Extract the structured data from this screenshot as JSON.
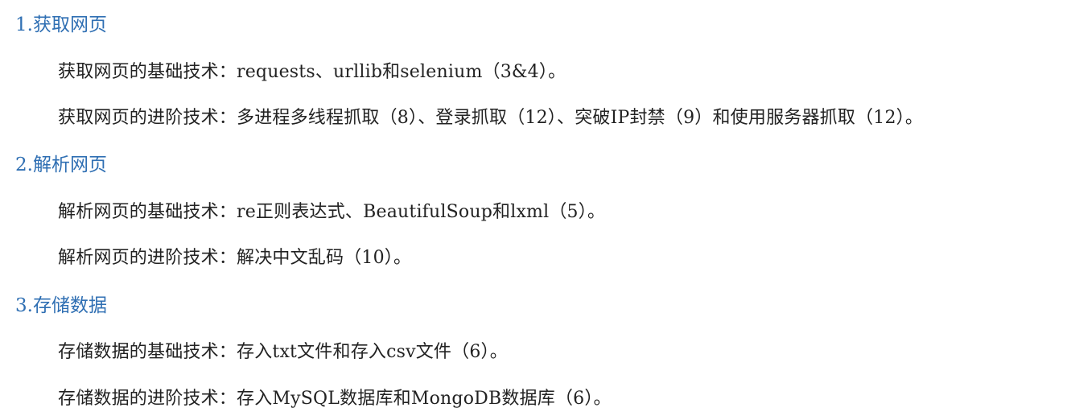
{
  "sections": [
    {
      "heading": "1.获取网页",
      "lines": [
        "获取网页的基础技术：requests、urllib和selenium（3&4）。",
        "获取网页的进阶技术：多进程多线程抓取（8）、登录抓取（12）、突破IP封禁（9）和使用服务器抓取（12）。"
      ]
    },
    {
      "heading": "2.解析网页",
      "lines": [
        "解析网页的基础技术：re正则表达式、BeautifulSoup和lxml（5）。",
        "解析网页的进阶技术：解决中文乱码（10）。"
      ]
    },
    {
      "heading": "3.存储数据",
      "lines": [
        "存储数据的基础技术：存入txt文件和存入csv文件（6）。",
        "存储数据的进阶技术：存入MySQL数据库和MongoDB数据库（6）。"
      ]
    }
  ],
  "colors": {
    "heading": "#2f6fb3",
    "text": "#222222"
  }
}
